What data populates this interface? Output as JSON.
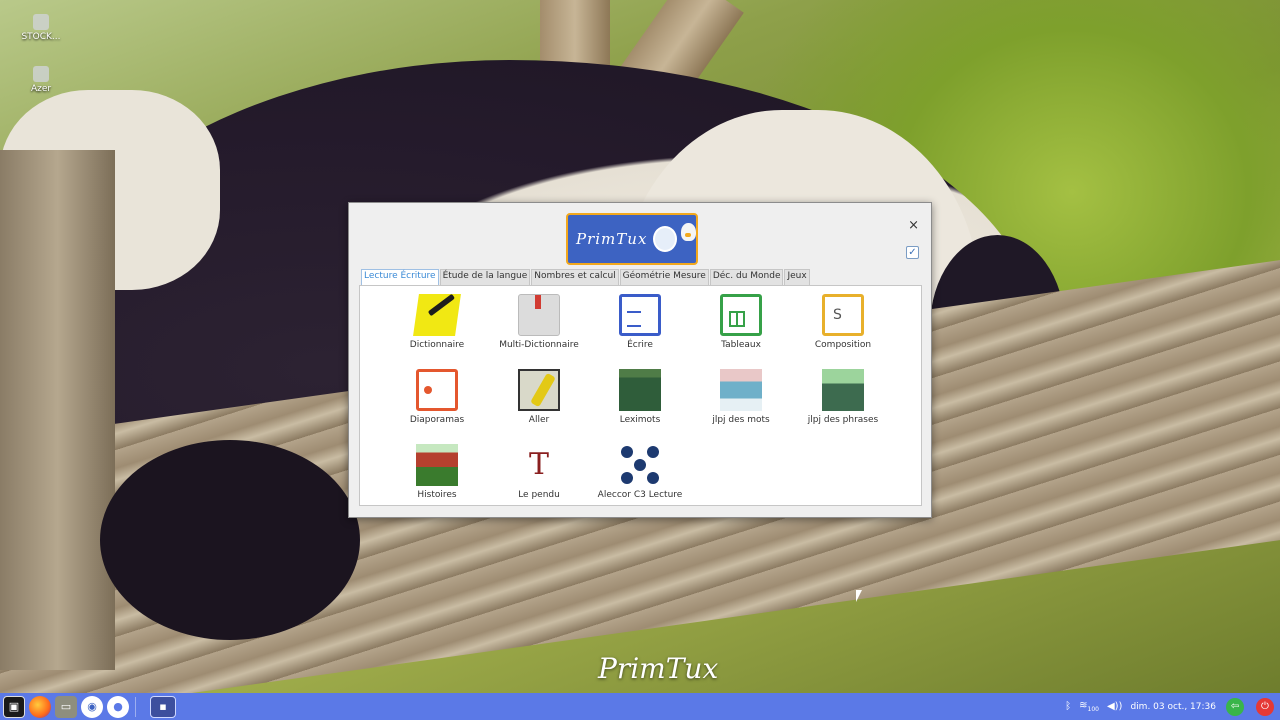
{
  "desktop": {
    "icons": [
      {
        "label": "STOCK..."
      },
      {
        "label": "Azer"
      }
    ],
    "brand": "PrimTux"
  },
  "dialog": {
    "close_glyph": "×",
    "checkbox_checked": true,
    "logo_text": "PrimTux",
    "tabs": [
      {
        "label": "Lecture Écriture",
        "active": true
      },
      {
        "label": "Étude de la langue"
      },
      {
        "label": "Nombres et calcul"
      },
      {
        "label": "Géométrie Mesure"
      },
      {
        "label": "Déc. du Monde"
      },
      {
        "label": "Jeux"
      }
    ],
    "apps": [
      {
        "label": "Dictionnaire",
        "icon": "dictionary-icon"
      },
      {
        "label": "Multi-Dictionnaire",
        "icon": "multi-dictionary-icon"
      },
      {
        "label": "Écrire",
        "icon": "writer-document-icon"
      },
      {
        "label": "Tableaux",
        "icon": "spreadsheet-icon"
      },
      {
        "label": "Composition",
        "icon": "draw-icon"
      },
      {
        "label": "Diaporamas",
        "icon": "presentation-icon"
      },
      {
        "label": "Aller",
        "icon": "aller-icon"
      },
      {
        "label": "Leximots",
        "icon": "leximots-icon"
      },
      {
        "label": "jlpj des mots",
        "icon": "jlpj-words-icon"
      },
      {
        "label": "jlpj des phrases",
        "icon": "jlpj-sentences-icon"
      },
      {
        "label": "Histoires",
        "icon": "histoires-icon"
      },
      {
        "label": "Le pendu",
        "icon": "hangman-icon"
      },
      {
        "label": "Aleccor C3 Lecture",
        "icon": "aleccor-icon"
      }
    ]
  },
  "taskbar": {
    "clock": "dim. 03 oct., 17:36",
    "volume_badge": "100"
  },
  "colors": {
    "taskbar": "#5b79e7",
    "active_tab": "#3a8ad6",
    "logo_bg": "#3d63c2",
    "logo_border": "#f2a81d"
  }
}
